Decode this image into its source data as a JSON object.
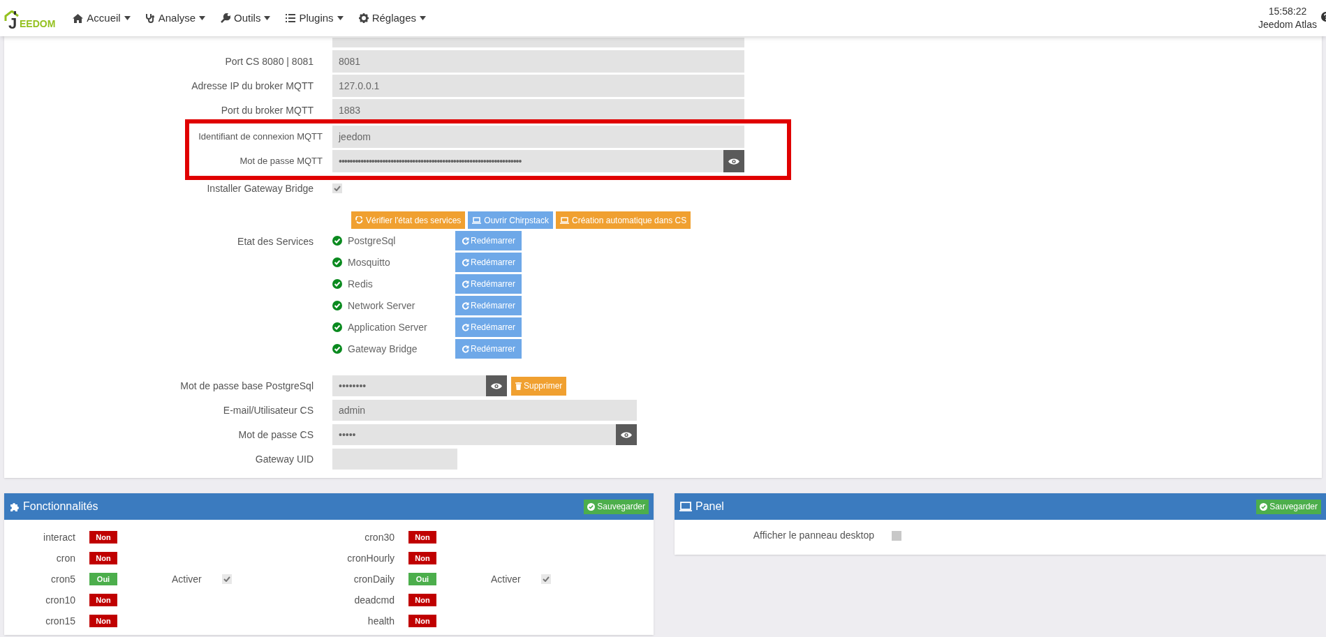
{
  "navbar": {
    "logo_initial": "J",
    "logo_rest": "EEDOM",
    "menu": [
      {
        "label": "Accueil"
      },
      {
        "label": "Analyse"
      },
      {
        "label": "Outils"
      },
      {
        "label": "Plugins"
      },
      {
        "label": "Réglages"
      }
    ],
    "clock": "15:58:22",
    "user": "Jeedom Atlas"
  },
  "config": {
    "fields": [
      {
        "kind": "text",
        "highlighted": false
      },
      {
        "kind": "text",
        "label": "Port CS 8080 | 8081",
        "value": "8081",
        "highlighted": false
      },
      {
        "kind": "text",
        "label": "Adresse IP du broker MQTT",
        "value": "127.0.0.1",
        "highlighted": false
      },
      {
        "kind": "text",
        "label": "Port du broker MQTT",
        "value": "1883",
        "highlighted": false
      },
      {
        "kind": "text",
        "label": "Identifiant de connexion MQTT",
        "value": "jeedom",
        "highlighted": true
      },
      {
        "kind": "password",
        "label": "Mot de passe MQTT",
        "value": "•••••••••••••••••••••••••••••••••••••••••••••••••••••••••••••••••••",
        "highlighted": true
      },
      {
        "kind": "checkbox",
        "label": "Installer Gateway Bridge",
        "checked": true,
        "highlighted": false
      }
    ],
    "action_buttons": [
      {
        "label": "Vérifier l'état des services",
        "color": "#f0a030"
      },
      {
        "label": "Ouvrir Chirpstack",
        "color": "#6ea8e8"
      },
      {
        "label": "Création automatique dans CS",
        "color": "#f0a030"
      }
    ],
    "services_label": "Etat des Services",
    "services": [
      {
        "name": "PostgreSql",
        "ok": true,
        "button": "Redémarrer"
      },
      {
        "name": "Mosquitto",
        "ok": true,
        "button": "Redémarrer"
      },
      {
        "name": "Redis",
        "ok": true,
        "button": "Redémarrer"
      },
      {
        "name": "Network Server",
        "ok": true,
        "button": "Redémarrer"
      },
      {
        "name": "Application Server",
        "ok": true,
        "button": "Redémarrer"
      },
      {
        "name": "Gateway Bridge",
        "ok": true,
        "button": "Redémarrer"
      }
    ],
    "lower_fields": [
      {
        "kind": "password",
        "label": "Mot de passe base PostgreSql",
        "value": "••••••••",
        "delete_button": "Supprimer"
      },
      {
        "kind": "text",
        "label": "E-mail/Utilisateur CS",
        "value": "admin"
      },
      {
        "kind": "password",
        "label": "Mot de passe CS",
        "value": "•••••"
      },
      {
        "kind": "text",
        "label": "Gateway UID"
      }
    ]
  },
  "features": {
    "title": "Fonctionnalités",
    "save": "Sauvegarder",
    "columns": [
      [
        {
          "name": "interact",
          "status": "Non",
          "on": false
        },
        {
          "name": "cron",
          "status": "Non",
          "on": false
        },
        {
          "name": "cron5",
          "status": "Oui",
          "on": true,
          "activate": "Activer",
          "checked": true
        },
        {
          "name": "cron10",
          "status": "Non",
          "on": false
        },
        {
          "name": "cron15",
          "status": "Non",
          "on": false
        }
      ],
      [
        {
          "name": "cron30",
          "status": "Non",
          "on": false
        },
        {
          "name": "cronHourly",
          "status": "Non",
          "on": false
        },
        {
          "name": "cronDaily",
          "status": "Oui",
          "on": true,
          "activate": "Activer",
          "checked": true
        },
        {
          "name": "deadcmd",
          "status": "Non",
          "on": false
        },
        {
          "name": "health",
          "status": "Non",
          "on": false
        }
      ]
    ]
  },
  "panel": {
    "title": "Panel",
    "save": "Sauvegarder",
    "option": "Afficher le panneau desktop",
    "checked": false
  }
}
